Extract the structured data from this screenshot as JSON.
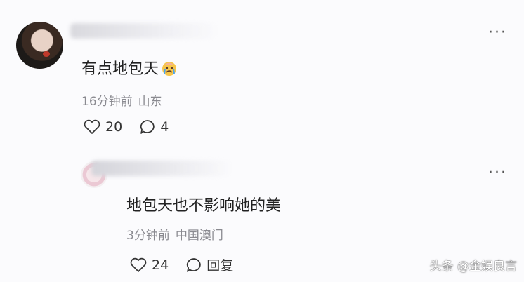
{
  "comments": [
    {
      "text": "有点地包天",
      "emoji": "crying-face-emoji",
      "time": "16分钟前",
      "location": "山东",
      "likes": "20",
      "replies": "4"
    },
    {
      "text": "地包天也不影响她的美",
      "time": "3分钟前",
      "location": "中国澳门",
      "likes": "24",
      "reply_label": "回复"
    }
  ],
  "more_label": "···",
  "watermark": "头条 @金娱良言",
  "colors": {
    "text": "#222222",
    "meta": "#8a8a90",
    "background": "#fbfbfd"
  }
}
